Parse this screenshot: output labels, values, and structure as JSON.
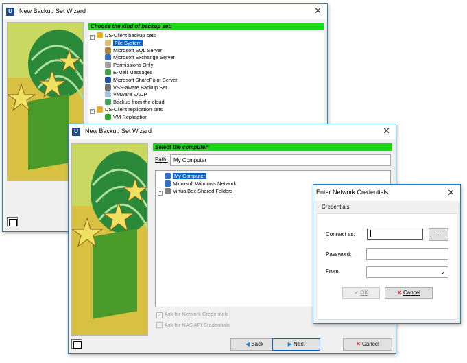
{
  "window1": {
    "title": "New Backup Set Wizard",
    "heading": "Choose the kind of backup set:",
    "tree": [
      {
        "label": "DS-Client backup sets",
        "level": 0,
        "expander": "−",
        "icon_color": "#e8b020"
      },
      {
        "label": "File System",
        "level": 1,
        "selected": true,
        "icon_color": "#d8c070"
      },
      {
        "label": "Microsoft SQL Server",
        "level": 1,
        "icon_color": "#b08040"
      },
      {
        "label": "Microsoft Exchange Server",
        "level": 1,
        "icon_color": "#3070c0"
      },
      {
        "label": "Permissions Only",
        "level": 1,
        "icon_color": "#a0a0a0"
      },
      {
        "label": "E-Mail Messages",
        "level": 1,
        "icon_color": "#40a040"
      },
      {
        "label": "Microsoft SharePoint Server",
        "level": 1,
        "icon_color": "#2050a0"
      },
      {
        "label": "VSS-aware Backup Set",
        "level": 1,
        "icon_color": "#707070"
      },
      {
        "label": "VMware VADP",
        "level": 1,
        "icon_color": "#a0c0e0"
      },
      {
        "label": "Backup from the cloud",
        "level": 1,
        "icon_color": "#40a060"
      },
      {
        "label": "DS-Client replication sets",
        "level": 0,
        "expander": "−",
        "icon_color": "#e8b020"
      },
      {
        "label": "VM Replication",
        "level": 1,
        "icon_color": "#30a030"
      }
    ]
  },
  "window2": {
    "title": "New Backup Set Wizard",
    "heading": "Select the computer:",
    "path_label": "Path:",
    "path_value": "My Computer",
    "tree": [
      {
        "label": "My Computer",
        "selected": true,
        "icon_color": "#3070c0"
      },
      {
        "label": "Microsoft Windows Network",
        "icon_color": "#3070c0"
      },
      {
        "label": "VirtualBox Shared Folders",
        "icon_color": "#808080",
        "expander": "+"
      }
    ],
    "check_network": "Ask for Network Credentials",
    "check_nas": "Ask for NAS API Credentials",
    "back_label": "Back",
    "next_label": "Next",
    "cancel_label": "Cancel"
  },
  "dialog": {
    "title": "Enter Network Credentials",
    "group_label": "Credentials",
    "connect_as_label": "Connect as:",
    "browse_label": "...",
    "password_label": "Password:",
    "from_label": "From:",
    "ok_label": "OK",
    "cancel_label": "Cancel"
  },
  "icons": {
    "app": "app-logo-icon",
    "close": "close-icon",
    "screen": "window-mode-icon"
  }
}
